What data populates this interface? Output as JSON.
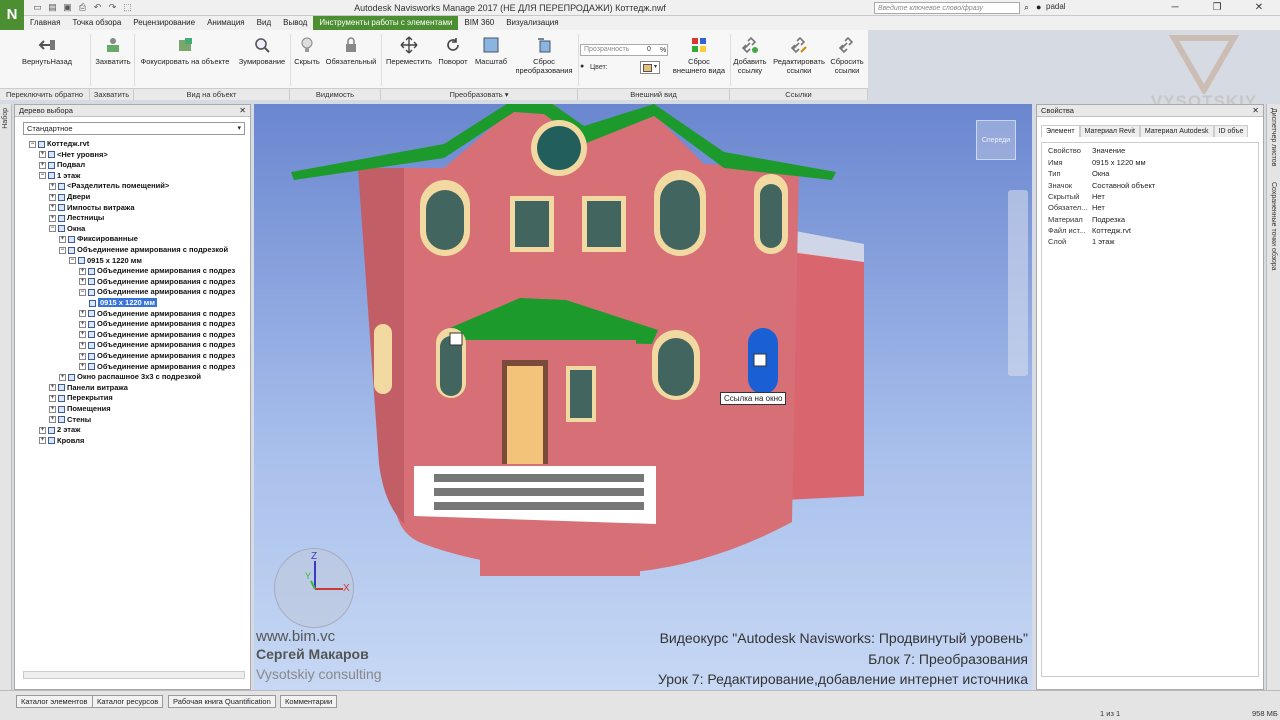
{
  "app": {
    "logo": "N",
    "title": "Autodesk Navisworks Manage 2017 (НЕ ДЛЯ ПЕРЕПРОДАЖИ)    Коттедж.nwf",
    "search_placeholder": "Введите ключевое слово/фразу",
    "user": "padal"
  },
  "menu_tabs": [
    "Главная",
    "Точка обзора",
    "Рецензирование",
    "Анимация",
    "Вид",
    "Вывод",
    "Инструменты работы с элементами",
    "BIM 360",
    "Визуализация"
  ],
  "active_tab": "Инструменты работы с элементами",
  "ribbon": {
    "buttons": {
      "return_back": "ВернутьНазад",
      "capture": "Захватить",
      "focus": "Фокусировать на объекте",
      "zoom": "Зумирование",
      "hide": "Скрыть",
      "required": "Обязательный",
      "move": "Переместить",
      "rotate": "Поворот",
      "scale": "Масштаб",
      "reset_transform_1": "Сброс",
      "reset_transform_2": "преобразования",
      "transparency": "Прозрачность",
      "transparency_value": "0",
      "transparency_unit": "%",
      "color": "Цвет:",
      "reset_appearance_1": "Сброс",
      "reset_appearance_2": "внешнего вида",
      "add_link_1": "Добавить",
      "add_link_2": "ссылку",
      "edit_link_1": "Редактировать",
      "edit_link_2": "ссылки",
      "reset_links_1": "Сбросить",
      "reset_links_2": "ссылки"
    },
    "groups": [
      "Переключить обратно",
      "Захватить",
      "Вид на объект",
      "Видимость",
      "Преобразовать ▾",
      "Внешний вид",
      "Ссылки"
    ]
  },
  "selection_tree": {
    "title": "Дерево выбора",
    "mode": "Стандартное",
    "nodes": [
      {
        "label": "Коттедж.rvt",
        "indent": 0,
        "exp": "−"
      },
      {
        "label": "<Нет уровня>",
        "indent": 1,
        "exp": "+"
      },
      {
        "label": "Подвал",
        "indent": 1,
        "exp": "+"
      },
      {
        "label": "1 этаж",
        "indent": 1,
        "exp": "−"
      },
      {
        "label": "<Разделитель помещений>",
        "indent": 2,
        "exp": "+"
      },
      {
        "label": "Двери",
        "indent": 2,
        "exp": "+"
      },
      {
        "label": "Импосты витража",
        "indent": 2,
        "exp": "+"
      },
      {
        "label": "Лестницы",
        "indent": 2,
        "exp": "+"
      },
      {
        "label": "Окна",
        "indent": 2,
        "exp": "−"
      },
      {
        "label": "Фиксированные",
        "indent": 3,
        "exp": "+"
      },
      {
        "label": "Объединение армирования с подрезкой",
        "indent": 3,
        "exp": "−"
      },
      {
        "label": "0915 x 1220 мм",
        "indent": 4,
        "exp": "−"
      },
      {
        "label": "Объединение армирования с подрез",
        "indent": 5,
        "exp": "+"
      },
      {
        "label": "Объединение армирования с подрез",
        "indent": 5,
        "exp": "+"
      },
      {
        "label": "Объединение армирования с подрез",
        "indent": 5,
        "exp": "−"
      },
      {
        "label": "0915 x 1220 мм",
        "indent": 6,
        "exp": "",
        "sel": true
      },
      {
        "label": "Объединение армирования с подрез",
        "indent": 5,
        "exp": "+"
      },
      {
        "label": "Объединение армирования с подрез",
        "indent": 5,
        "exp": "+"
      },
      {
        "label": "Объединение армирования с подрез",
        "indent": 5,
        "exp": "+"
      },
      {
        "label": "Объединение армирования с подрез",
        "indent": 5,
        "exp": "+"
      },
      {
        "label": "Объединение армирования с подрез",
        "indent": 5,
        "exp": "+"
      },
      {
        "label": "Объединение армирования с подрез",
        "indent": 5,
        "exp": "+"
      },
      {
        "label": "Окно распашное 3x3 с подрезкой",
        "indent": 3,
        "exp": "+"
      },
      {
        "label": "Панели витража",
        "indent": 2,
        "exp": "+"
      },
      {
        "label": "Перекрытия",
        "indent": 2,
        "exp": "+"
      },
      {
        "label": "Помещения",
        "indent": 2,
        "exp": "+"
      },
      {
        "label": "Стены",
        "indent": 2,
        "exp": "+"
      },
      {
        "label": "2 этаж",
        "indent": 1,
        "exp": "+"
      },
      {
        "label": "Кровля",
        "indent": 1,
        "exp": "+"
      }
    ]
  },
  "left_strip_label": "Набор",
  "viewport": {
    "tooltip": "Ссылка на окно",
    "viewcube": "Спереди",
    "axis_x": "X",
    "axis_y": "Y",
    "axis_z": "Z"
  },
  "overlay": {
    "site": "www.bim.vc",
    "author": "Сергей Макаров",
    "company": "Vysotskiy consulting",
    "line1": "Видеокурс \"Autodesk Navisworks: Продвинутый уровень\"",
    "line2": "Блок 7: Преобразования",
    "line3": "Урок 7: Редактирование,добавление интернет источника",
    "brand": "VYSOTSKIY"
  },
  "properties": {
    "title": "Свойства",
    "tabs": [
      "Элемент",
      "Материал Revit",
      "Материал Autodesk",
      "ID объе"
    ],
    "header": {
      "k": "Свойство",
      "v": "Значение"
    },
    "rows": [
      {
        "k": "Имя",
        "v": "0915 x 1220 мм"
      },
      {
        "k": "Тип",
        "v": "Окна"
      },
      {
        "k": "Значок",
        "v": "Составной объект"
      },
      {
        "k": "Скрытый",
        "v": "Нет"
      },
      {
        "k": "Обязател...",
        "v": "Нет"
      },
      {
        "k": "Материал",
        "v": "Подрезка"
      },
      {
        "k": "Файл ист...",
        "v": "Коттедж.rvt"
      },
      {
        "k": "Слой",
        "v": "1 этаж"
      }
    ]
  },
  "right_strip": {
    "a": "Диспетчер листов",
    "b": "Сохраненные точки обзора"
  },
  "bottom_tabs": [
    "Каталог элементов",
    "Каталог ресурсов",
    "Рабочая книга Quantification",
    "Комментарии"
  ],
  "status": {
    "pages": "1 из 1",
    "memory": "958 МБ"
  }
}
